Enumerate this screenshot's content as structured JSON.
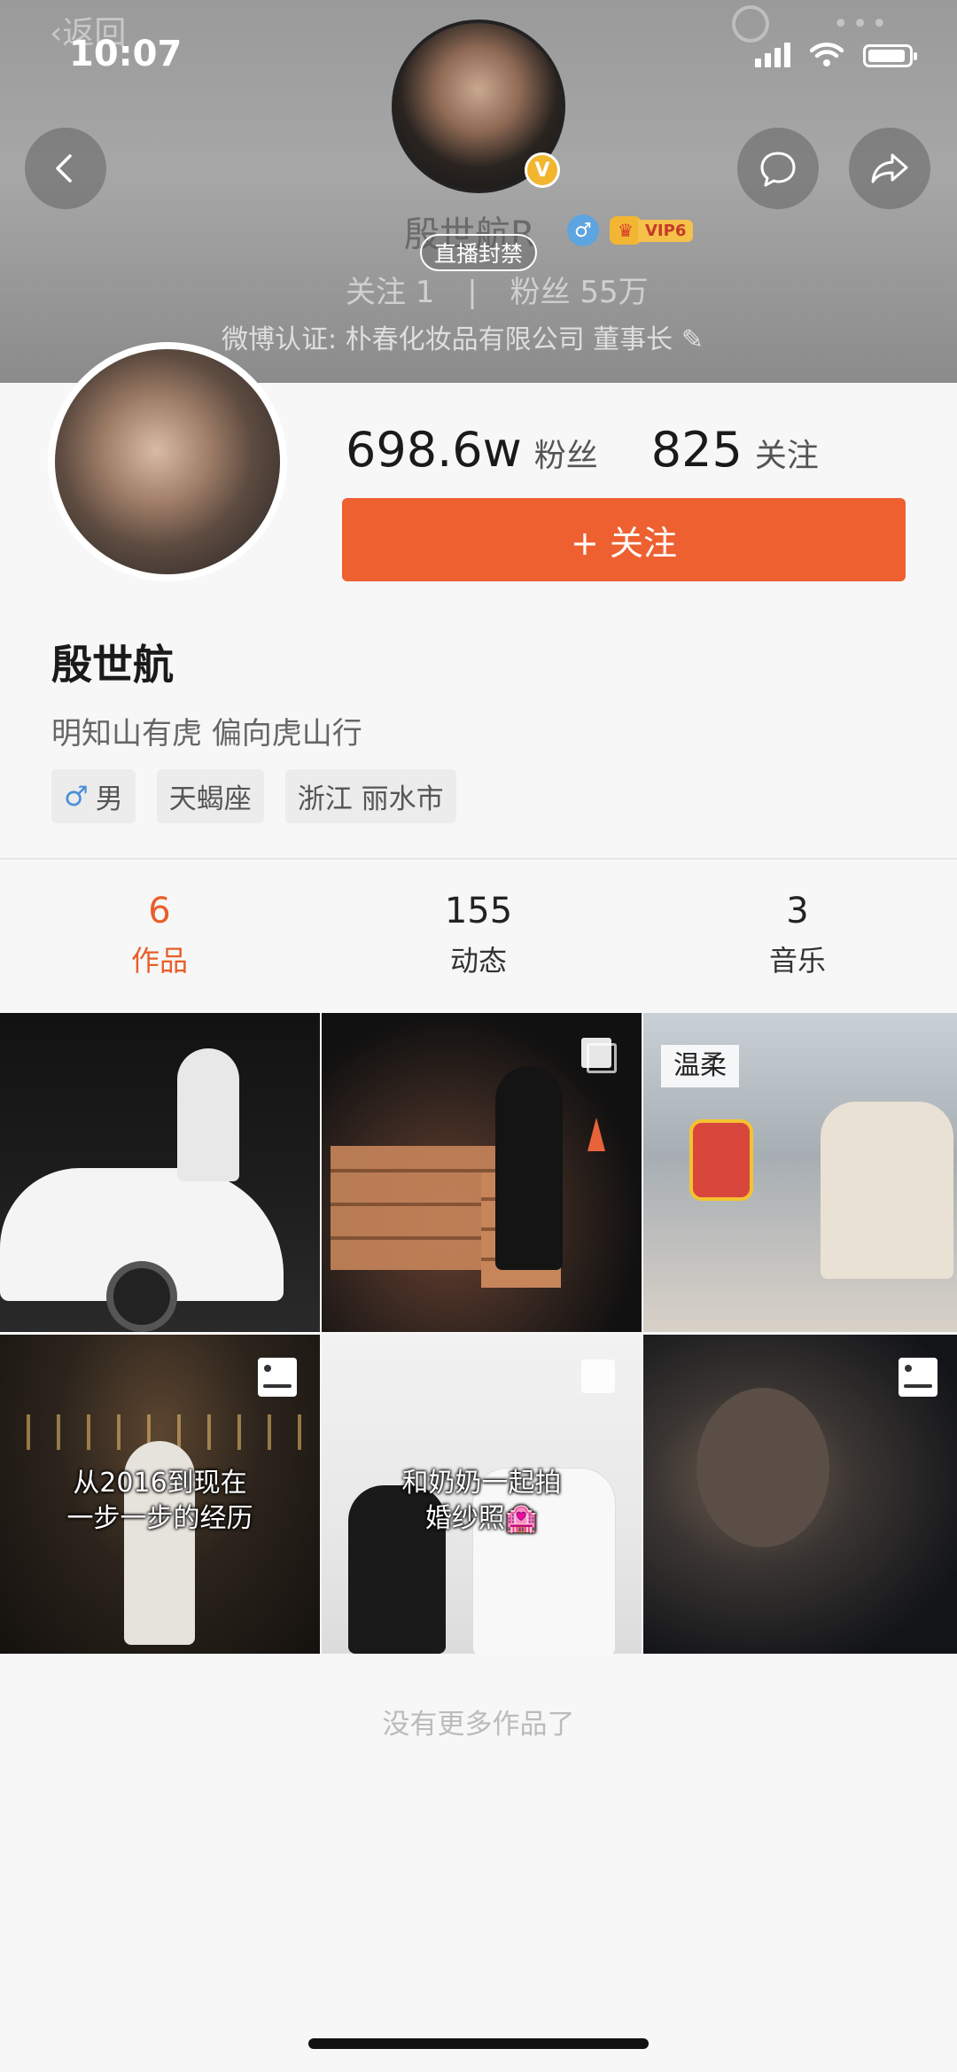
{
  "status_bar": {
    "time": "10:07"
  },
  "header": {
    "ghost_back": "返回",
    "name": "殷世航R",
    "live_ban": "直播封禁",
    "vip_label": "VIP6",
    "follow_line": {
      "follow_label": "关注",
      "follow_count": "1",
      "fans_label": "粉丝",
      "fans_count": "55万"
    },
    "verification": "微博认证: 朴春化妆品有限公司 董事长"
  },
  "profile": {
    "fans_count": "698.6w",
    "fans_label": "粉丝",
    "following_count": "825",
    "following_label": "关注",
    "follow_button": "+ 关注",
    "name": "殷世航",
    "bio": "明知山有虎 偏向虎山行",
    "tags": {
      "gender": "男",
      "zodiac": "天蝎座",
      "location": "浙江 丽水市"
    }
  },
  "tabs": [
    {
      "count": "6",
      "label": "作品"
    },
    {
      "count": "155",
      "label": "动态"
    },
    {
      "count": "3",
      "label": "音乐"
    }
  ],
  "grid": {
    "item3_label": "温柔",
    "item4_caption_1": "从2016到现在",
    "item4_caption_2": "一步一步的经历",
    "item5_caption_1": "和奶奶一起拍",
    "item5_caption_2": "婚纱照🏩"
  },
  "footer": {
    "no_more": "没有更多作品了"
  },
  "colors": {
    "accent": "#ee6030",
    "active_tab": "#e95e2a",
    "vip_gold": "#f5c149"
  },
  "icons": [
    "back-icon",
    "message-icon",
    "share-icon",
    "search-icon",
    "more-icon",
    "verified-v-icon",
    "male-icon",
    "crown-icon",
    "multi-image-icon",
    "frame-icon",
    "wifi-icon",
    "signal-icon",
    "battery-icon"
  ]
}
